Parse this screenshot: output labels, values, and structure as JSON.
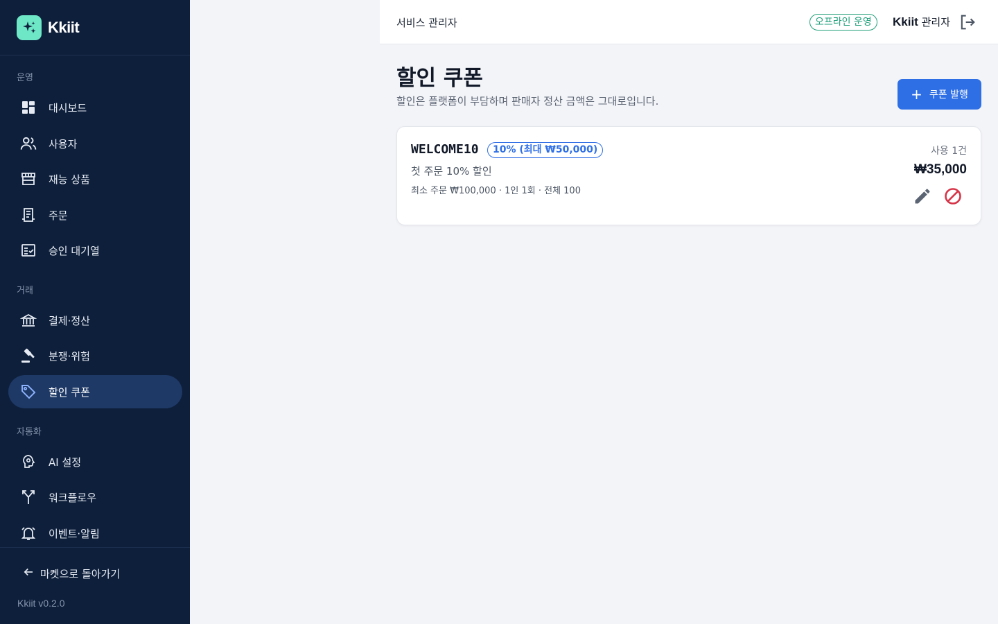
{
  "brand": {
    "name": "Kkiit"
  },
  "sidebar": {
    "sections": [
      "운영",
      "거래",
      "자동화"
    ],
    "items": [
      {
        "label": "대시보드",
        "icon": "dashboard-icon"
      },
      {
        "label": "사용자",
        "icon": "users-icon"
      },
      {
        "label": "재능 상품",
        "icon": "storefront-icon"
      },
      {
        "label": "주문",
        "icon": "receipt-icon"
      },
      {
        "label": "승인 대기열",
        "icon": "approval-checklist-icon"
      },
      {
        "label": "결제·정산",
        "icon": "bank-icon"
      },
      {
        "label": "분쟁·위험",
        "icon": "gavel-icon"
      },
      {
        "label": "할인 쿠폰",
        "icon": "tag-icon",
        "active": true
      },
      {
        "label": "AI 설정",
        "icon": "ai-brain-icon"
      },
      {
        "label": "워크플로우",
        "icon": "workflow-fork-icon"
      },
      {
        "label": "이벤트·알림",
        "icon": "alarm-bell-icon"
      }
    ],
    "back_label": "마켓으로 돌아가기",
    "version": "Kkiit v0.2.0"
  },
  "header": {
    "title": "서비스 관리자",
    "mode_badge": "오프라인 운영",
    "admin_brand": "Kkiit",
    "admin_role": "관리자"
  },
  "main": {
    "title": "할인 쿠폰",
    "subtitle": "할인은 플랫폼이 부담하며 판매자 정산 금액은 그대로입니다.",
    "issue_label": "쿠폰 발행",
    "coupons": [
      {
        "code": "WELCOME10",
        "discount": "10% (최대 ₩50,000)",
        "description": "첫 주문 10% 할인",
        "terms": "최소 주문 ₩100,000 · 1인 1회 · 전체 100",
        "usage": "사용 1건",
        "amount": "₩35,000"
      }
    ]
  },
  "colors": {
    "sidebar_bg": "#0e1f3b",
    "active_item_bg": "#1e3966",
    "primary": "#2f6fe6",
    "success": "#1f9e78",
    "danger": "#d63447"
  }
}
